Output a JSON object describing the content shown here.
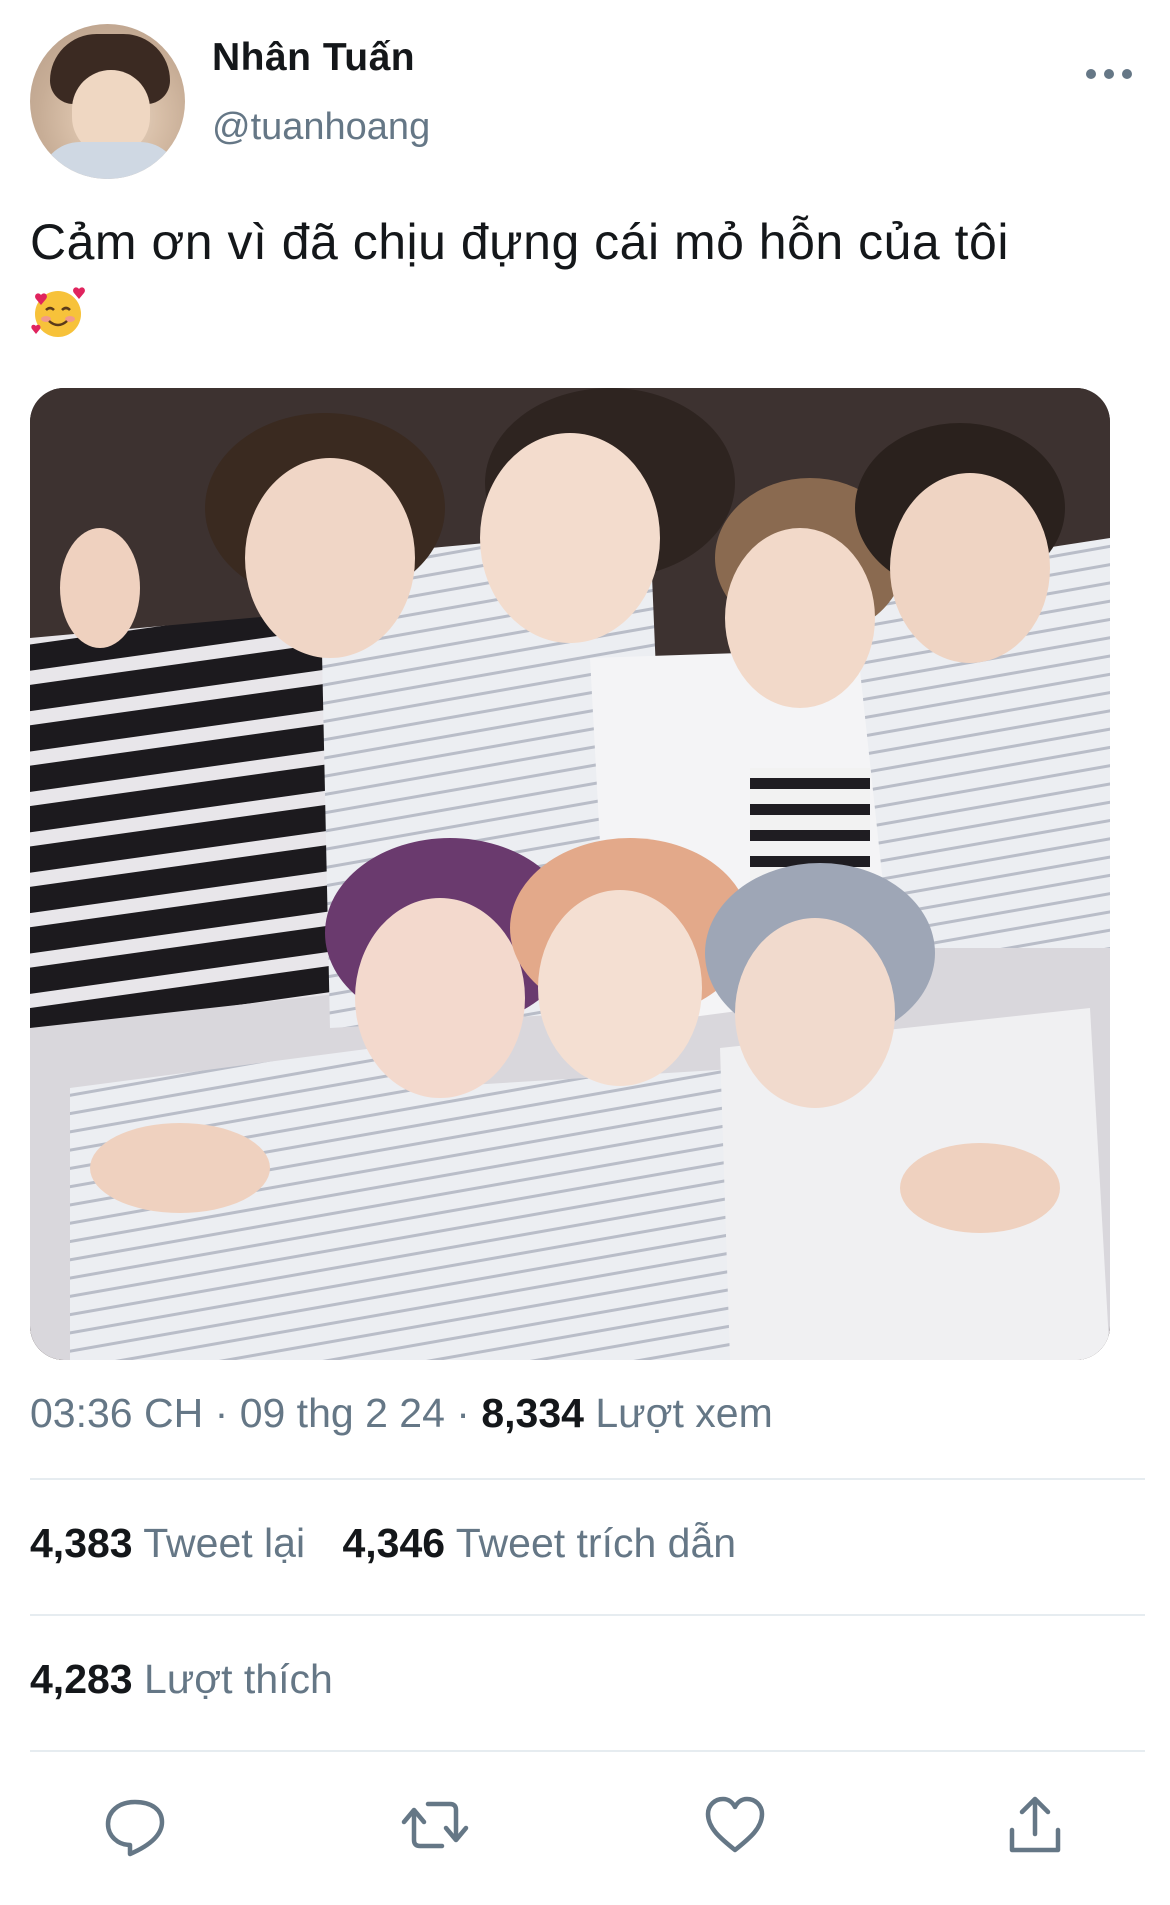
{
  "user": {
    "display_name": "Nhân Tuấn",
    "handle": "@tuanhoang",
    "avatar_icon": "profile-photo"
  },
  "header": {
    "more_icon": "more-horizontal-icon"
  },
  "tweet": {
    "text": "Cảm ơn vì đã chịu đựng cái mỏ hỗn của tôi",
    "emoji": "🥰",
    "media_icon": "group-photo"
  },
  "meta": {
    "time": "03:36 CH",
    "separator": "·",
    "date": "09 thg 2 24",
    "views_count": "8,334",
    "views_label": "Lượt xem"
  },
  "stats": {
    "retweets_count": "4,383",
    "retweets_label": "Tweet lại",
    "quotes_count": "4,346",
    "quotes_label": "Tweet trích dẫn",
    "likes_count": "4,283",
    "likes_label": "Lượt thích"
  },
  "actions": {
    "reply_icon": "reply-icon",
    "retweet_icon": "retweet-icon",
    "like_icon": "heart-icon",
    "share_icon": "share-icon"
  },
  "colors": {
    "text_primary": "#14171a",
    "text_secondary": "#657786",
    "divider": "#e6ecf0",
    "icon": "#657786"
  }
}
